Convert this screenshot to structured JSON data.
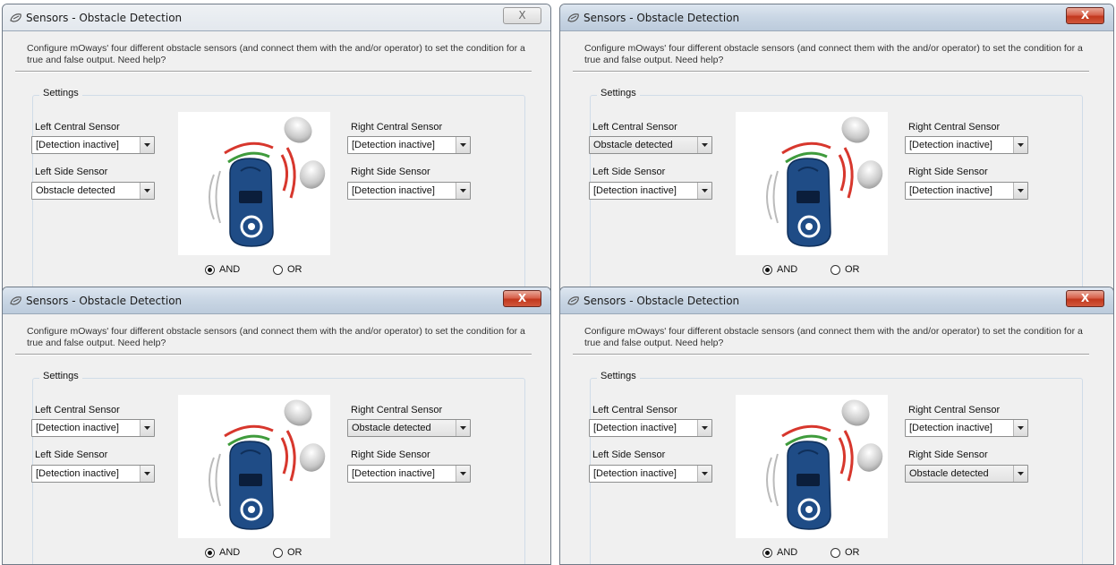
{
  "title": "Sensors - Obstacle Detection",
  "description": "Configure mOways' four different obstacle sensors (and connect them with the and/or operator) to set the condition for a true and false output. Need help?",
  "settings_label": "Settings",
  "labels": {
    "left_central": "Left Central Sensor",
    "left_side": "Left Side Sensor",
    "right_central": "Right Central Sensor",
    "right_side": "Right Side Sensor"
  },
  "operators": {
    "and": "AND",
    "or": "OR",
    "selected": "AND"
  },
  "close_glyph": "X",
  "panels": [
    {
      "active": false,
      "left_central": "[Detection inactive]",
      "left_side": "Obstacle detected",
      "right_central": "[Detection inactive]",
      "right_side": "[Detection inactive]",
      "highlighted": ""
    },
    {
      "active": true,
      "left_central": "Obstacle detected",
      "left_side": "[Detection inactive]",
      "right_central": "[Detection inactive]",
      "right_side": "[Detection inactive]",
      "highlighted": "left_central"
    },
    {
      "active": true,
      "left_central": "[Detection inactive]",
      "left_side": "[Detection inactive]",
      "right_central": "Obstacle detected",
      "right_side": "[Detection inactive]",
      "highlighted": "right_central"
    },
    {
      "active": true,
      "left_central": "[Detection inactive]",
      "left_side": "[Detection inactive]",
      "right_central": "[Detection inactive]",
      "right_side": "Obstacle detected",
      "highlighted": "right_side"
    }
  ],
  "colors": {
    "robot_body": "#1f4c86",
    "signal_red": "#d7372d",
    "signal_green": "#3f9b3c",
    "close_active": "#c94a30"
  },
  "icons": {
    "title": "mouse-icon",
    "dropdown": "chevron-down-icon",
    "robot": "moway-robot-illustration"
  }
}
